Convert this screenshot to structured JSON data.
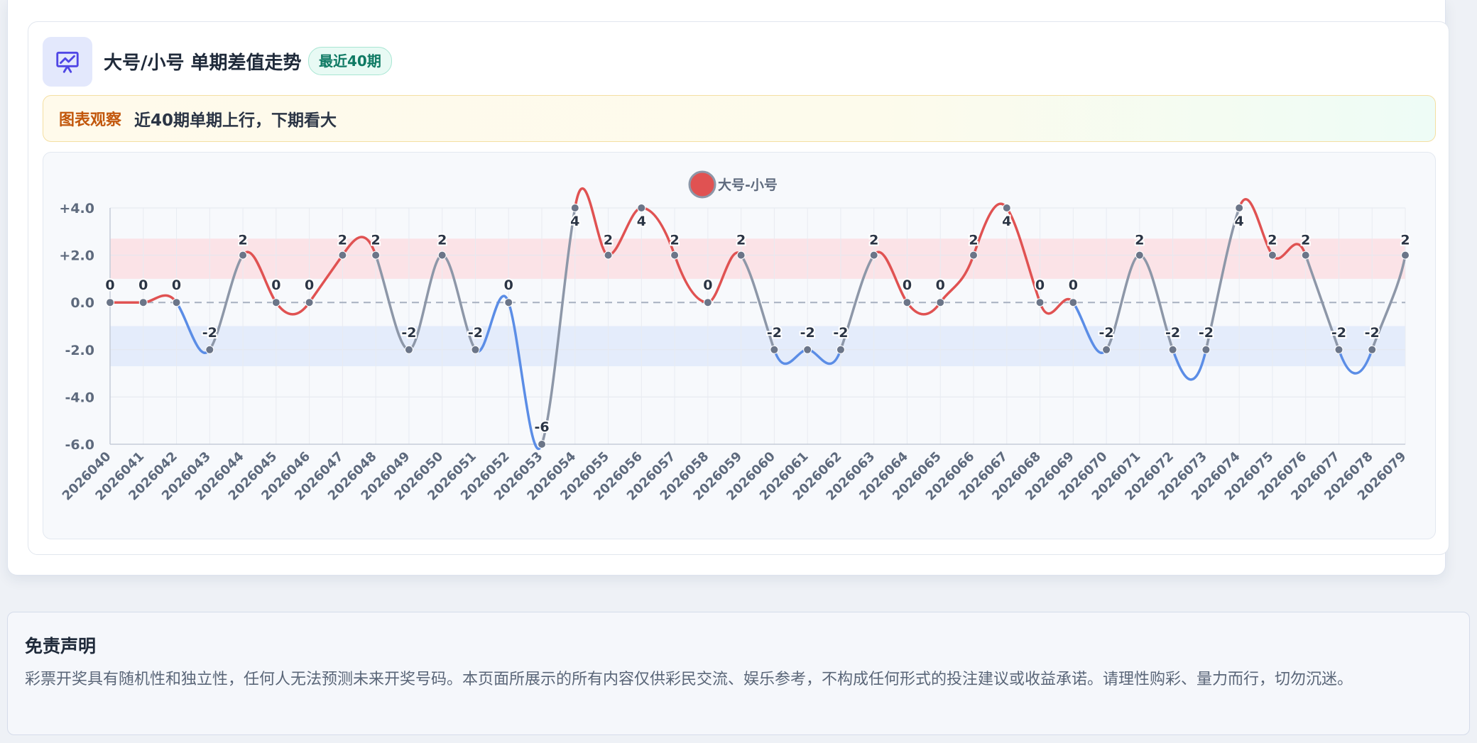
{
  "header": {
    "title": "大号/小号 单期差值走势",
    "badge": "最近40期",
    "icon": "presentation-chart-icon"
  },
  "insight": {
    "label": "图表观察",
    "text": "近40期单期上行，下期看大"
  },
  "disclaimer": {
    "title": "免责声明",
    "text": "彩票开奖具有随机性和独立性，任何人无法预测未来开奖号码。本页面所展示的所有内容仅供彩民交流、娱乐参考，不构成任何形式的投注建议或收益承诺。请理性购彩、量力而行，切勿沉迷。"
  },
  "colors": {
    "positive": "#e05252",
    "negative": "#5b8de6",
    "neutral": "#8d97a8",
    "point": "#6b7588",
    "band_positive": "#fbe3e7",
    "band_negative": "#e4ecfb",
    "accent_icon": "#4f46e5"
  },
  "chart_data": {
    "type": "line",
    "legend": "大号-小号",
    "legend_position": "top-center",
    "ylim": [
      -6,
      4
    ],
    "yticks": [
      4,
      2,
      0,
      -2,
      -4,
      -6
    ],
    "ytick_labels": [
      "+4.0",
      "+2.0",
      "0.0",
      "-2.0",
      "-4.0",
      "-6.0"
    ],
    "grid": true,
    "bands": [
      [
        1,
        2.7
      ],
      [
        -2.7,
        -1
      ]
    ],
    "x": [
      "2026040",
      "2026041",
      "2026042",
      "2026043",
      "2026044",
      "2026045",
      "2026046",
      "2026047",
      "2026048",
      "2026049",
      "2026050",
      "2026051",
      "2026052",
      "2026053",
      "2026054",
      "2026055",
      "2026056",
      "2026057",
      "2026058",
      "2026059",
      "2026060",
      "2026061",
      "2026062",
      "2026063",
      "2026064",
      "2026065",
      "2026066",
      "2026067",
      "2026068",
      "2026069",
      "2026070",
      "2026071",
      "2026072",
      "2026073",
      "2026074",
      "2026075",
      "2026076",
      "2026077",
      "2026078",
      "2026079"
    ],
    "values": [
      0,
      0,
      0,
      -2,
      2,
      0,
      0,
      2,
      2,
      -2,
      2,
      -2,
      0,
      -6,
      4,
      2,
      4,
      2,
      0,
      2,
      -2,
      -2,
      -2,
      2,
      0,
      0,
      2,
      4,
      0,
      0,
      -2,
      2,
      -2,
      -2,
      4,
      2,
      2,
      -2,
      -2,
      2
    ]
  }
}
